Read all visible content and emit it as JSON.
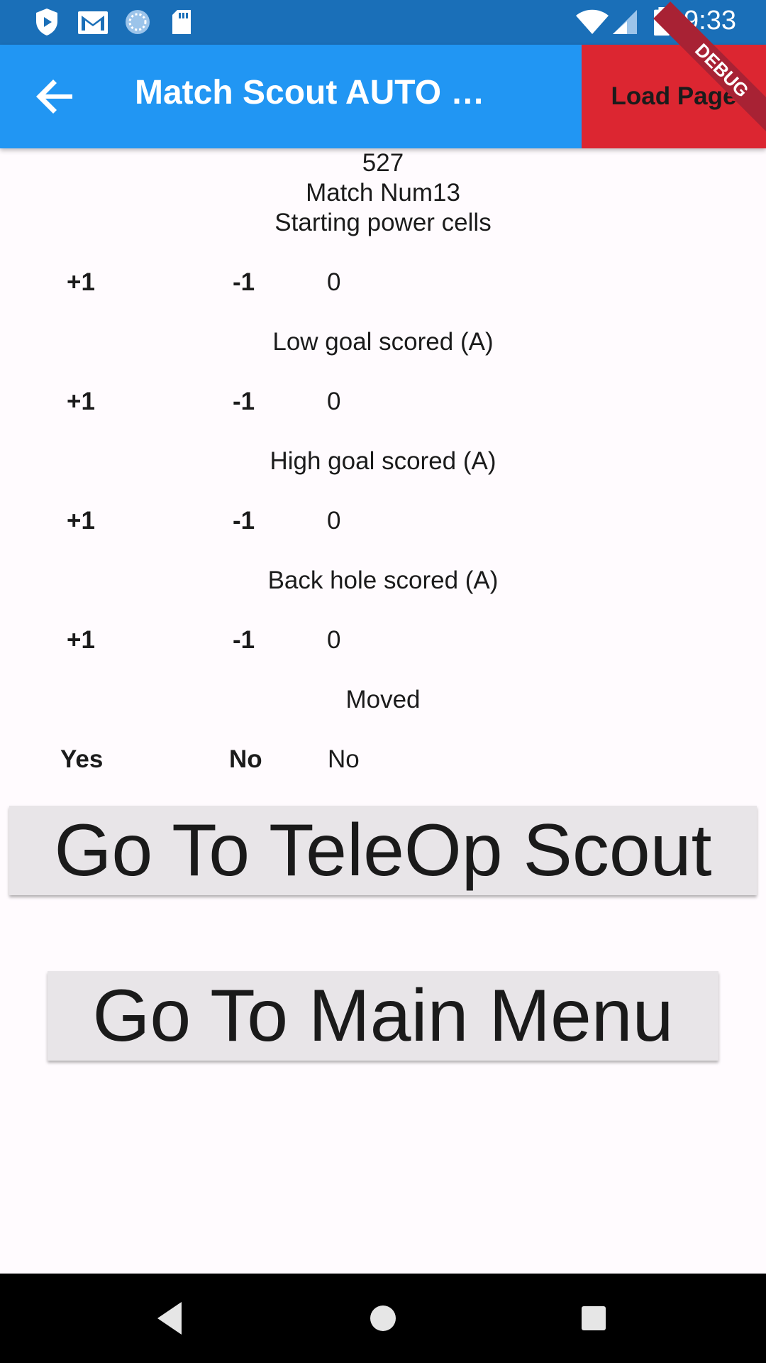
{
  "status_bar": {
    "time": "9:33",
    "icons": [
      "play-protect-icon",
      "gmail-icon",
      "sync-icon",
      "sd-card-icon",
      "wifi-icon",
      "signal-icon",
      "battery-icon"
    ]
  },
  "app_bar": {
    "title": "Match Scout AUTO …",
    "load_page_label": "Load Page",
    "debug_label": "DEBUG"
  },
  "header": {
    "team": "527",
    "match": "Match Num13",
    "starting_label": "Starting power cells"
  },
  "counters": [
    {
      "plus": "+1",
      "minus": "-1",
      "value": "0"
    },
    {
      "label": "Low goal scored (A)",
      "plus": "+1",
      "minus": "-1",
      "value": "0"
    },
    {
      "label": "High goal scored (A)",
      "plus": "+1",
      "minus": "-1",
      "value": "0"
    },
    {
      "label": "Back hole scored (A)",
      "plus": "+1",
      "minus": "-1",
      "value": "0"
    }
  ],
  "moved": {
    "label": "Moved",
    "yes": "Yes",
    "no": "No",
    "value": "No"
  },
  "buttons": {
    "teleop": "Go To TeleOp Scout",
    "main_menu": "Go To Main Menu"
  },
  "colors": {
    "status_bar": "#1a6fb8",
    "app_bar": "#2196f3",
    "load_page": "#dc2631",
    "background": "#fffbfe"
  }
}
